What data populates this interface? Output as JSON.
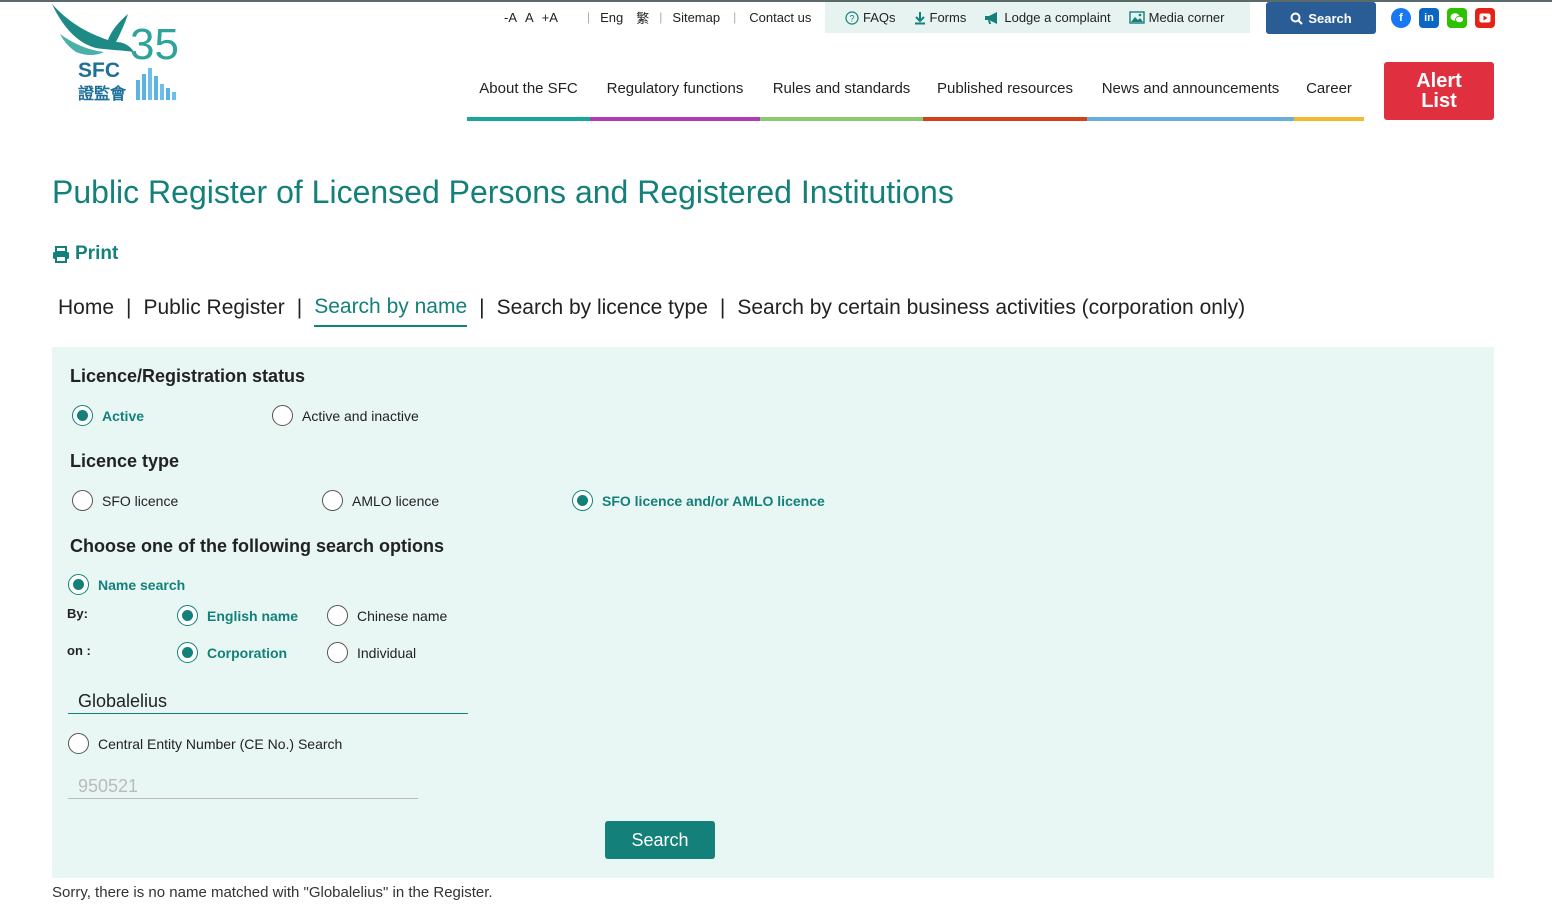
{
  "brand": {
    "logo_text": "SFC",
    "logo_chinese": "證監會",
    "anniversary": "35"
  },
  "utility": {
    "font_decrease": "-A",
    "font_normal": "A",
    "font_increase": "+A",
    "lang_en": "Eng",
    "lang_zh": "繁",
    "sitemap": "Sitemap",
    "contact": "Contact us"
  },
  "quick_links": [
    {
      "label": "FAQs",
      "icon": "question-circle-icon"
    },
    {
      "label": "Forms",
      "icon": "download-icon"
    },
    {
      "label": "Lodge a complaint",
      "icon": "megaphone-icon"
    },
    {
      "label": "Media corner",
      "icon": "image-icon"
    }
  ],
  "search_button": "Search",
  "social": [
    {
      "name": "facebook-icon",
      "color": "#1877f2"
    },
    {
      "name": "linkedin-icon",
      "color": "#0a66c2"
    },
    {
      "name": "wechat-icon",
      "color": "#2dc100"
    },
    {
      "name": "youtube-icon",
      "color": "#e62117"
    }
  ],
  "nav": [
    {
      "label": "About the SFC",
      "color": "#1ba69c"
    },
    {
      "label": "Regulatory functions",
      "color": "#b03bb5"
    },
    {
      "label": "Rules and standards",
      "color": "#8acb72"
    },
    {
      "label": "Published resources",
      "color": "#d5401c"
    },
    {
      "label": "News and announcements",
      "color": "#6aaedc"
    },
    {
      "label": "Career",
      "color": "#f4b92c"
    }
  ],
  "alert_list": "Alert List",
  "page_title": "Public Register of Licensed Persons and Registered Institutions",
  "print_label": "Print",
  "subnav": {
    "home": "Home",
    "public_register": "Public Register",
    "search_by_name": "Search by name",
    "search_by_licence_type": "Search by licence type",
    "search_by_business": "Search by certain business activities (corporation only)"
  },
  "form": {
    "status_heading": "Licence/Registration status",
    "status_active": "Active",
    "status_active_inactive": "Active and inactive",
    "type_heading": "Licence type",
    "type_sfo": "SFO licence",
    "type_amlo": "AMLO licence",
    "type_both": "SFO licence and/or AMLO licence",
    "options_heading": "Choose one of the following search options",
    "name_search": "Name search",
    "by_label": "By:",
    "english_name": "English name",
    "chinese_name": "Chinese name",
    "on_label": "on :",
    "corporation": "Corporation",
    "individual": "Individual",
    "name_value": "Globalelius",
    "ce_search": "Central Entity Number (CE No.) Search",
    "ce_placeholder": "950521",
    "submit": "Search"
  },
  "result_message": "Sorry, there is no name matched with \"Globalelius\" in the Register.",
  "colors": {
    "accent": "#14807a",
    "panel": "#e8f6f4",
    "search_blue": "#2a5d96",
    "alert_red": "#e0303f"
  }
}
